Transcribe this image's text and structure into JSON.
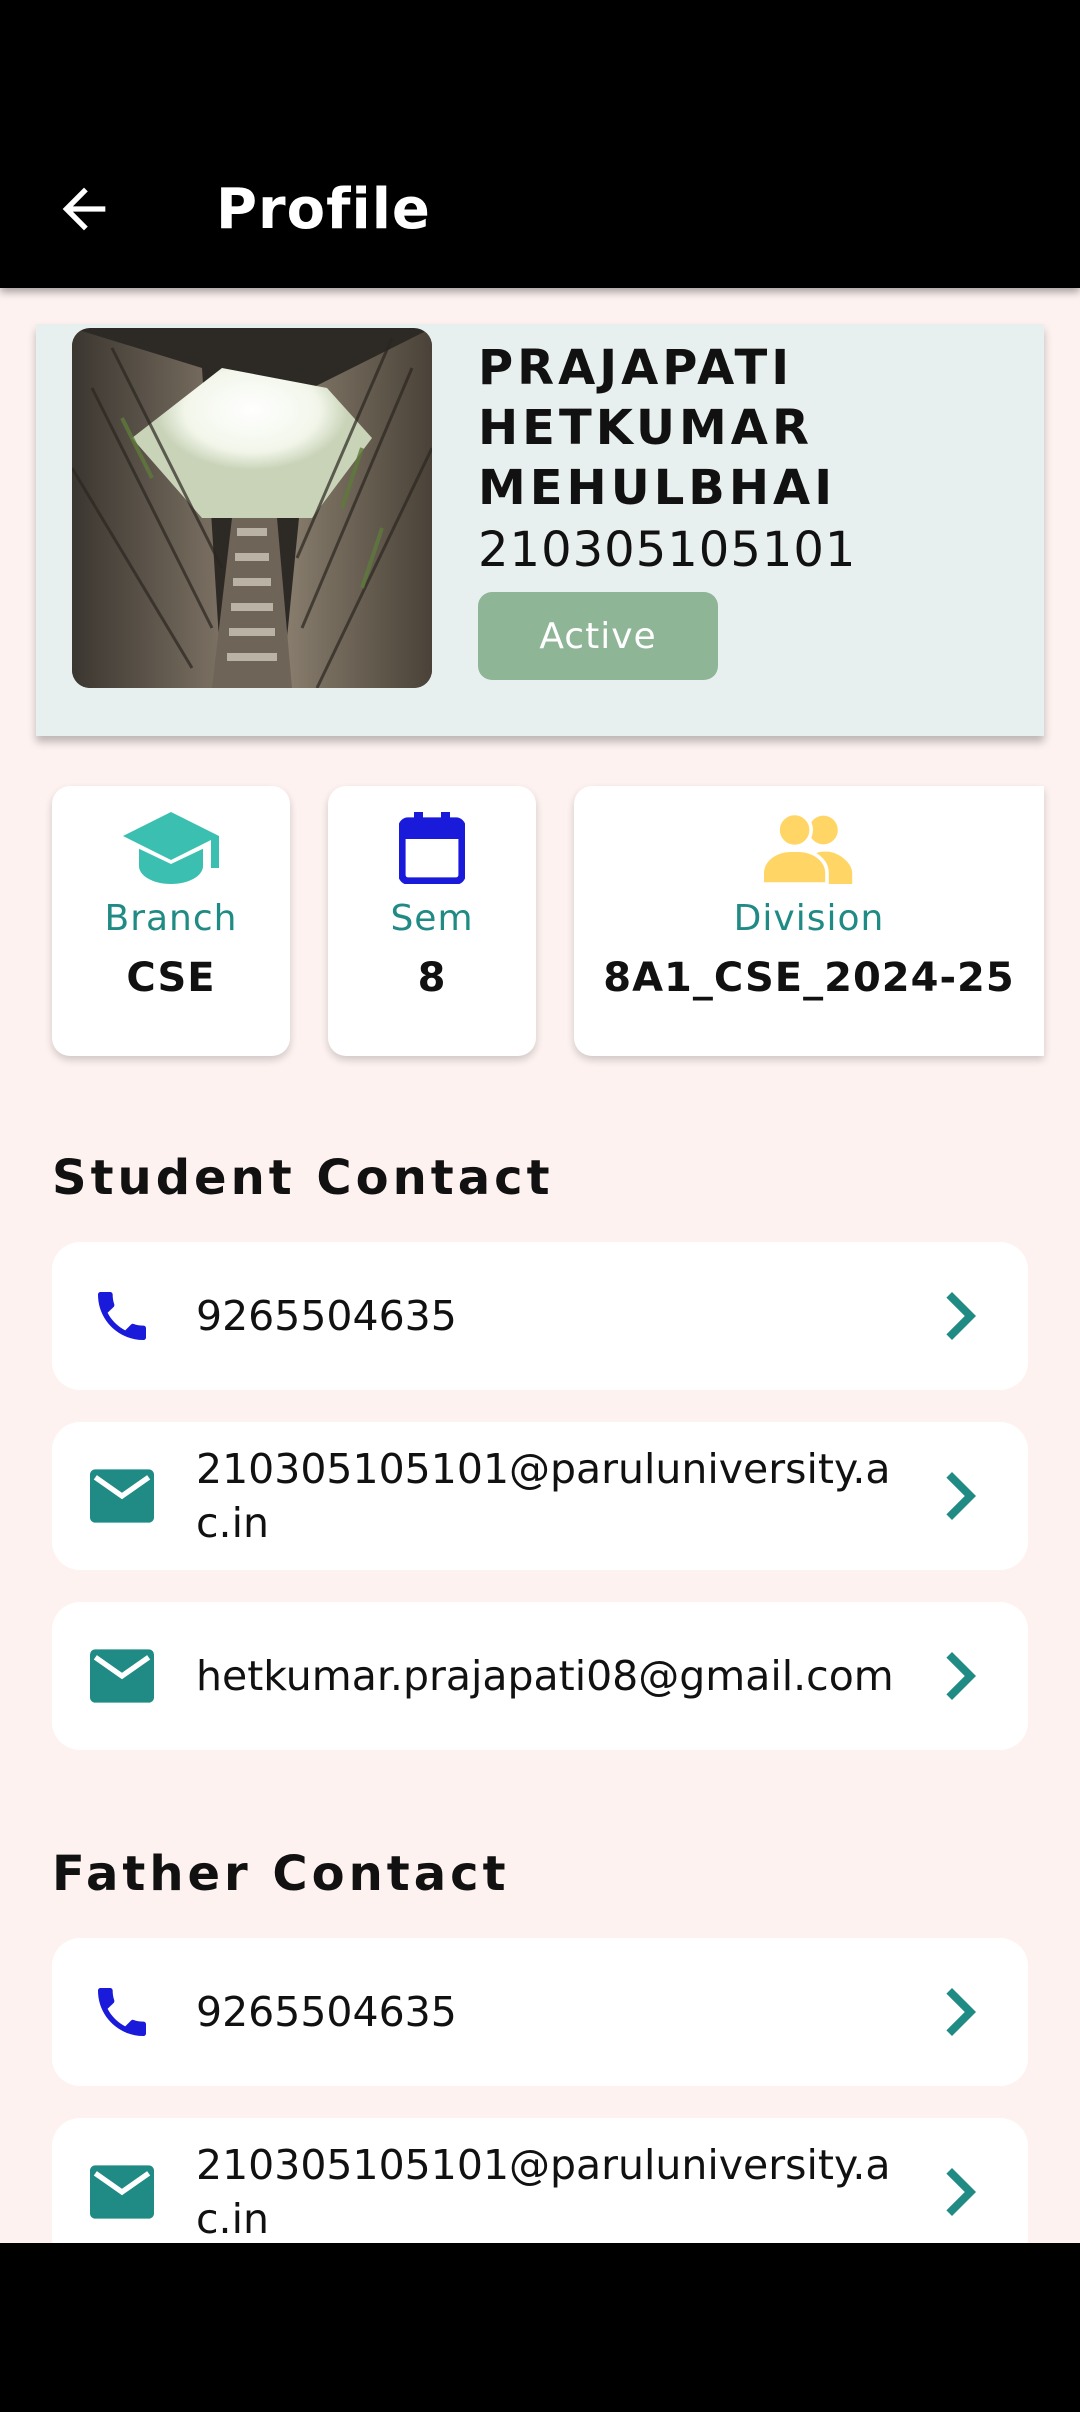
{
  "app_bar": {
    "title": "Profile"
  },
  "profile": {
    "name": "PRAJAPATI HETKUMAR MEHULBHAI",
    "enrollment": "210305105101",
    "status": "Active",
    "colors": {
      "status_badge": "#8fb597",
      "card_bg": "#e8f0ef"
    }
  },
  "info_cards": [
    {
      "icon": "graduation-cap-icon",
      "label": "Branch",
      "value": "CSE",
      "icon_color": "#3bbfb0"
    },
    {
      "icon": "calendar-icon",
      "label": "Sem",
      "value": "8",
      "icon_color": "#1a1adb"
    },
    {
      "icon": "group-icon",
      "label": "Division",
      "value": "8A1_CSE_2024-25",
      "icon_color": "#ffd666"
    }
  ],
  "student_contact": {
    "title": "Student Contact",
    "items": [
      {
        "icon": "phone-icon",
        "text": "9265504635"
      },
      {
        "icon": "mail-icon",
        "text": "210305105101@paruluniversity.ac.in"
      },
      {
        "icon": "mail-icon",
        "text": "hetkumar.prajapati08@gmail.com"
      }
    ]
  },
  "father_contact": {
    "title": "Father Contact",
    "items": [
      {
        "icon": "phone-icon",
        "text": "9265504635"
      },
      {
        "icon": "mail-icon",
        "text": "210305105101@paruluniversity.ac.in"
      }
    ]
  },
  "colors": {
    "accent_teal": "#208a84",
    "phone_blue": "#1a1adb",
    "background": "#fdf2f0"
  }
}
